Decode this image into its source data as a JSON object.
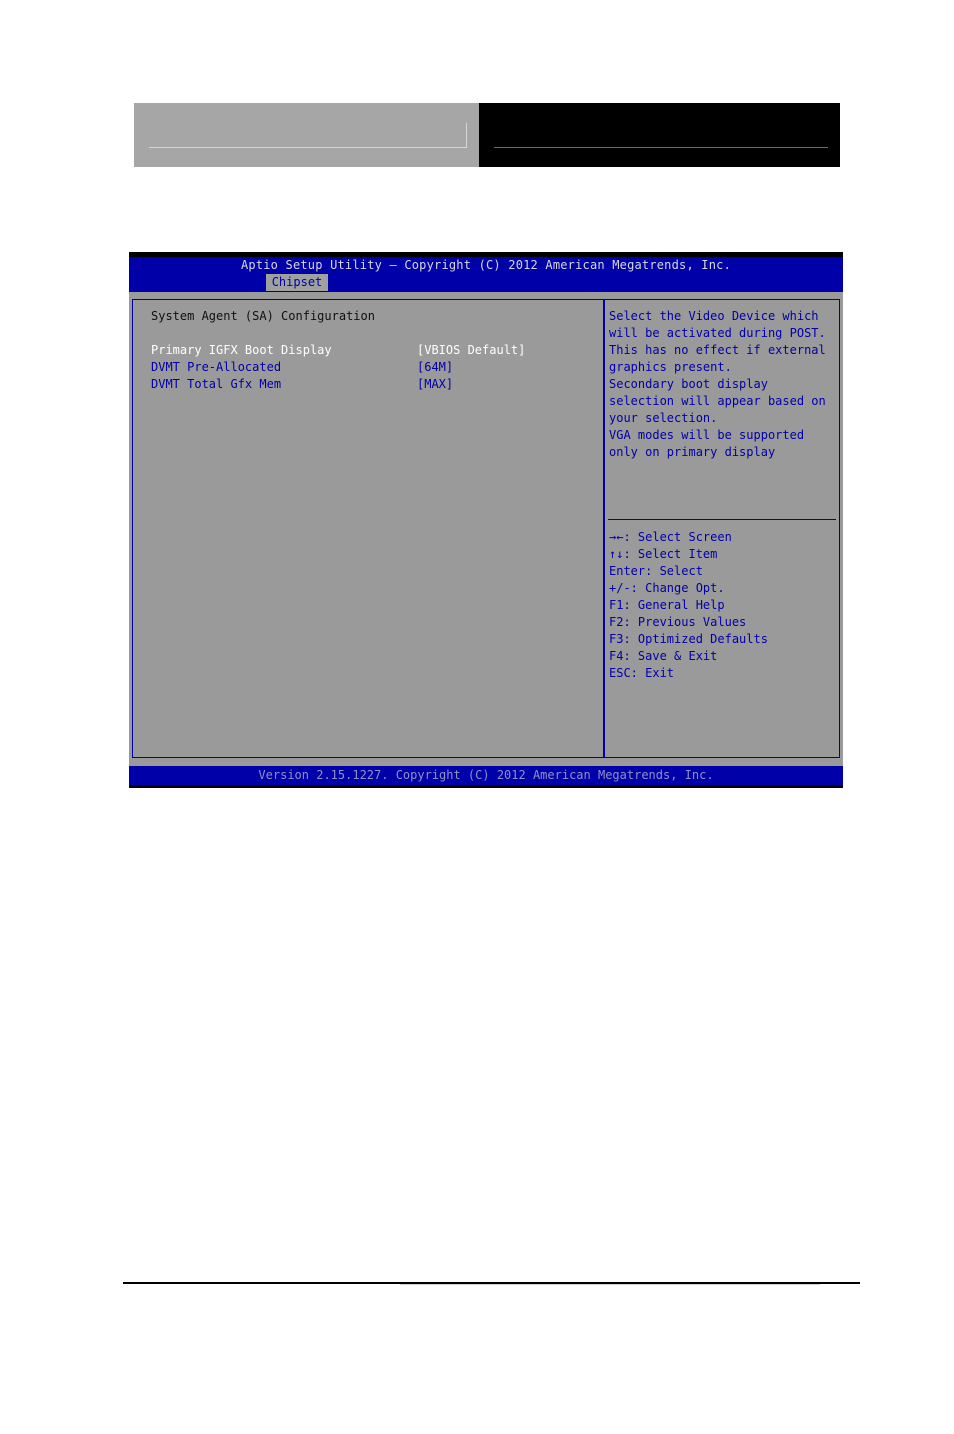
{
  "page_header": {
    "left_band_color": "#a6a6a6",
    "right_band_color": "#000000"
  },
  "bios": {
    "title": "Aptio Setup Utility – Copyright (C) 2012 American Megatrends, Inc.",
    "active_tab": "Chipset",
    "section_title": "System Agent (SA) Configuration",
    "settings": [
      {
        "label": "Primary IGFX Boot Display",
        "value": "[VBIOS Default]",
        "selected": true
      },
      {
        "label": "DVMT Pre-Allocated",
        "value": "[64M]",
        "selected": false
      },
      {
        "label": "DVMT Total Gfx Mem",
        "value": "[MAX]",
        "selected": false
      }
    ],
    "help_text": [
      "Select the Video Device which",
      "will be activated during POST.",
      "This has no effect if external",
      "graphics present.",
      "Secondary boot display",
      "selection will appear based on",
      "your selection.",
      "VGA modes will be supported",
      "only on primary display"
    ],
    "key_help": [
      "→←: Select Screen",
      "↑↓: Select Item",
      "Enter: Select",
      "+/-: Change Opt.",
      "F1: General Help",
      "F2: Previous Values",
      "F3: Optimized Defaults",
      "F4: Save & Exit",
      "ESC: Exit"
    ],
    "footer": "Version 2.15.1227. Copyright (C) 2012 American Megatrends, Inc.",
    "colors": {
      "bar_blue": "#0000a8",
      "panel_gray": "#9a9a9a",
      "selected_text": "#ffffff",
      "item_text": "#0000a8"
    }
  }
}
